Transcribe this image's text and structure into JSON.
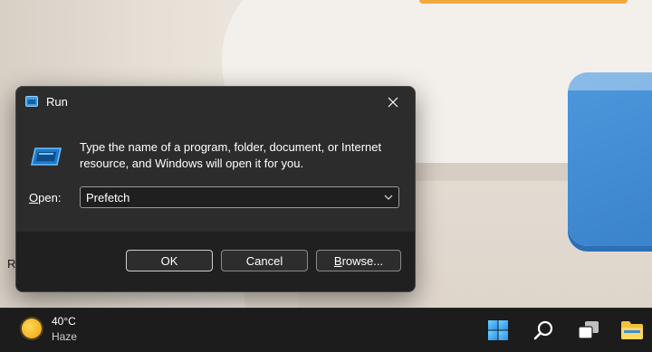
{
  "desktop": {
    "partial_text": "R"
  },
  "dialog": {
    "title": "Run",
    "description": "Type the name of a program, folder, document, or Internet resource, and Windows will open it for you.",
    "open_label_prefix": "",
    "open_label_mnemonic": "O",
    "open_label_suffix": "pen:",
    "input_value": "Prefetch",
    "ok_label": "OK",
    "cancel_label": "Cancel",
    "browse_mnemonic": "B",
    "browse_rest": "rowse...",
    "icons": [
      "run-app-icon",
      "close-icon",
      "chevron-down-icon"
    ]
  },
  "taskbar": {
    "weather": {
      "temperature": "40°C",
      "condition": "Haze",
      "icon": "sun-icon"
    },
    "icons": [
      "windows-start-icon",
      "search-icon",
      "task-view-icon",
      "file-explorer-icon"
    ]
  },
  "colors": {
    "dialog_bg": "#2c2c2c",
    "dialog_footer": "#202020",
    "taskbar_bg": "#1c1c1c",
    "accent_blue": "#4aa0e6",
    "wallpaper_blue": "#4d97dd",
    "wallpaper_orange": "#f0a93a"
  }
}
